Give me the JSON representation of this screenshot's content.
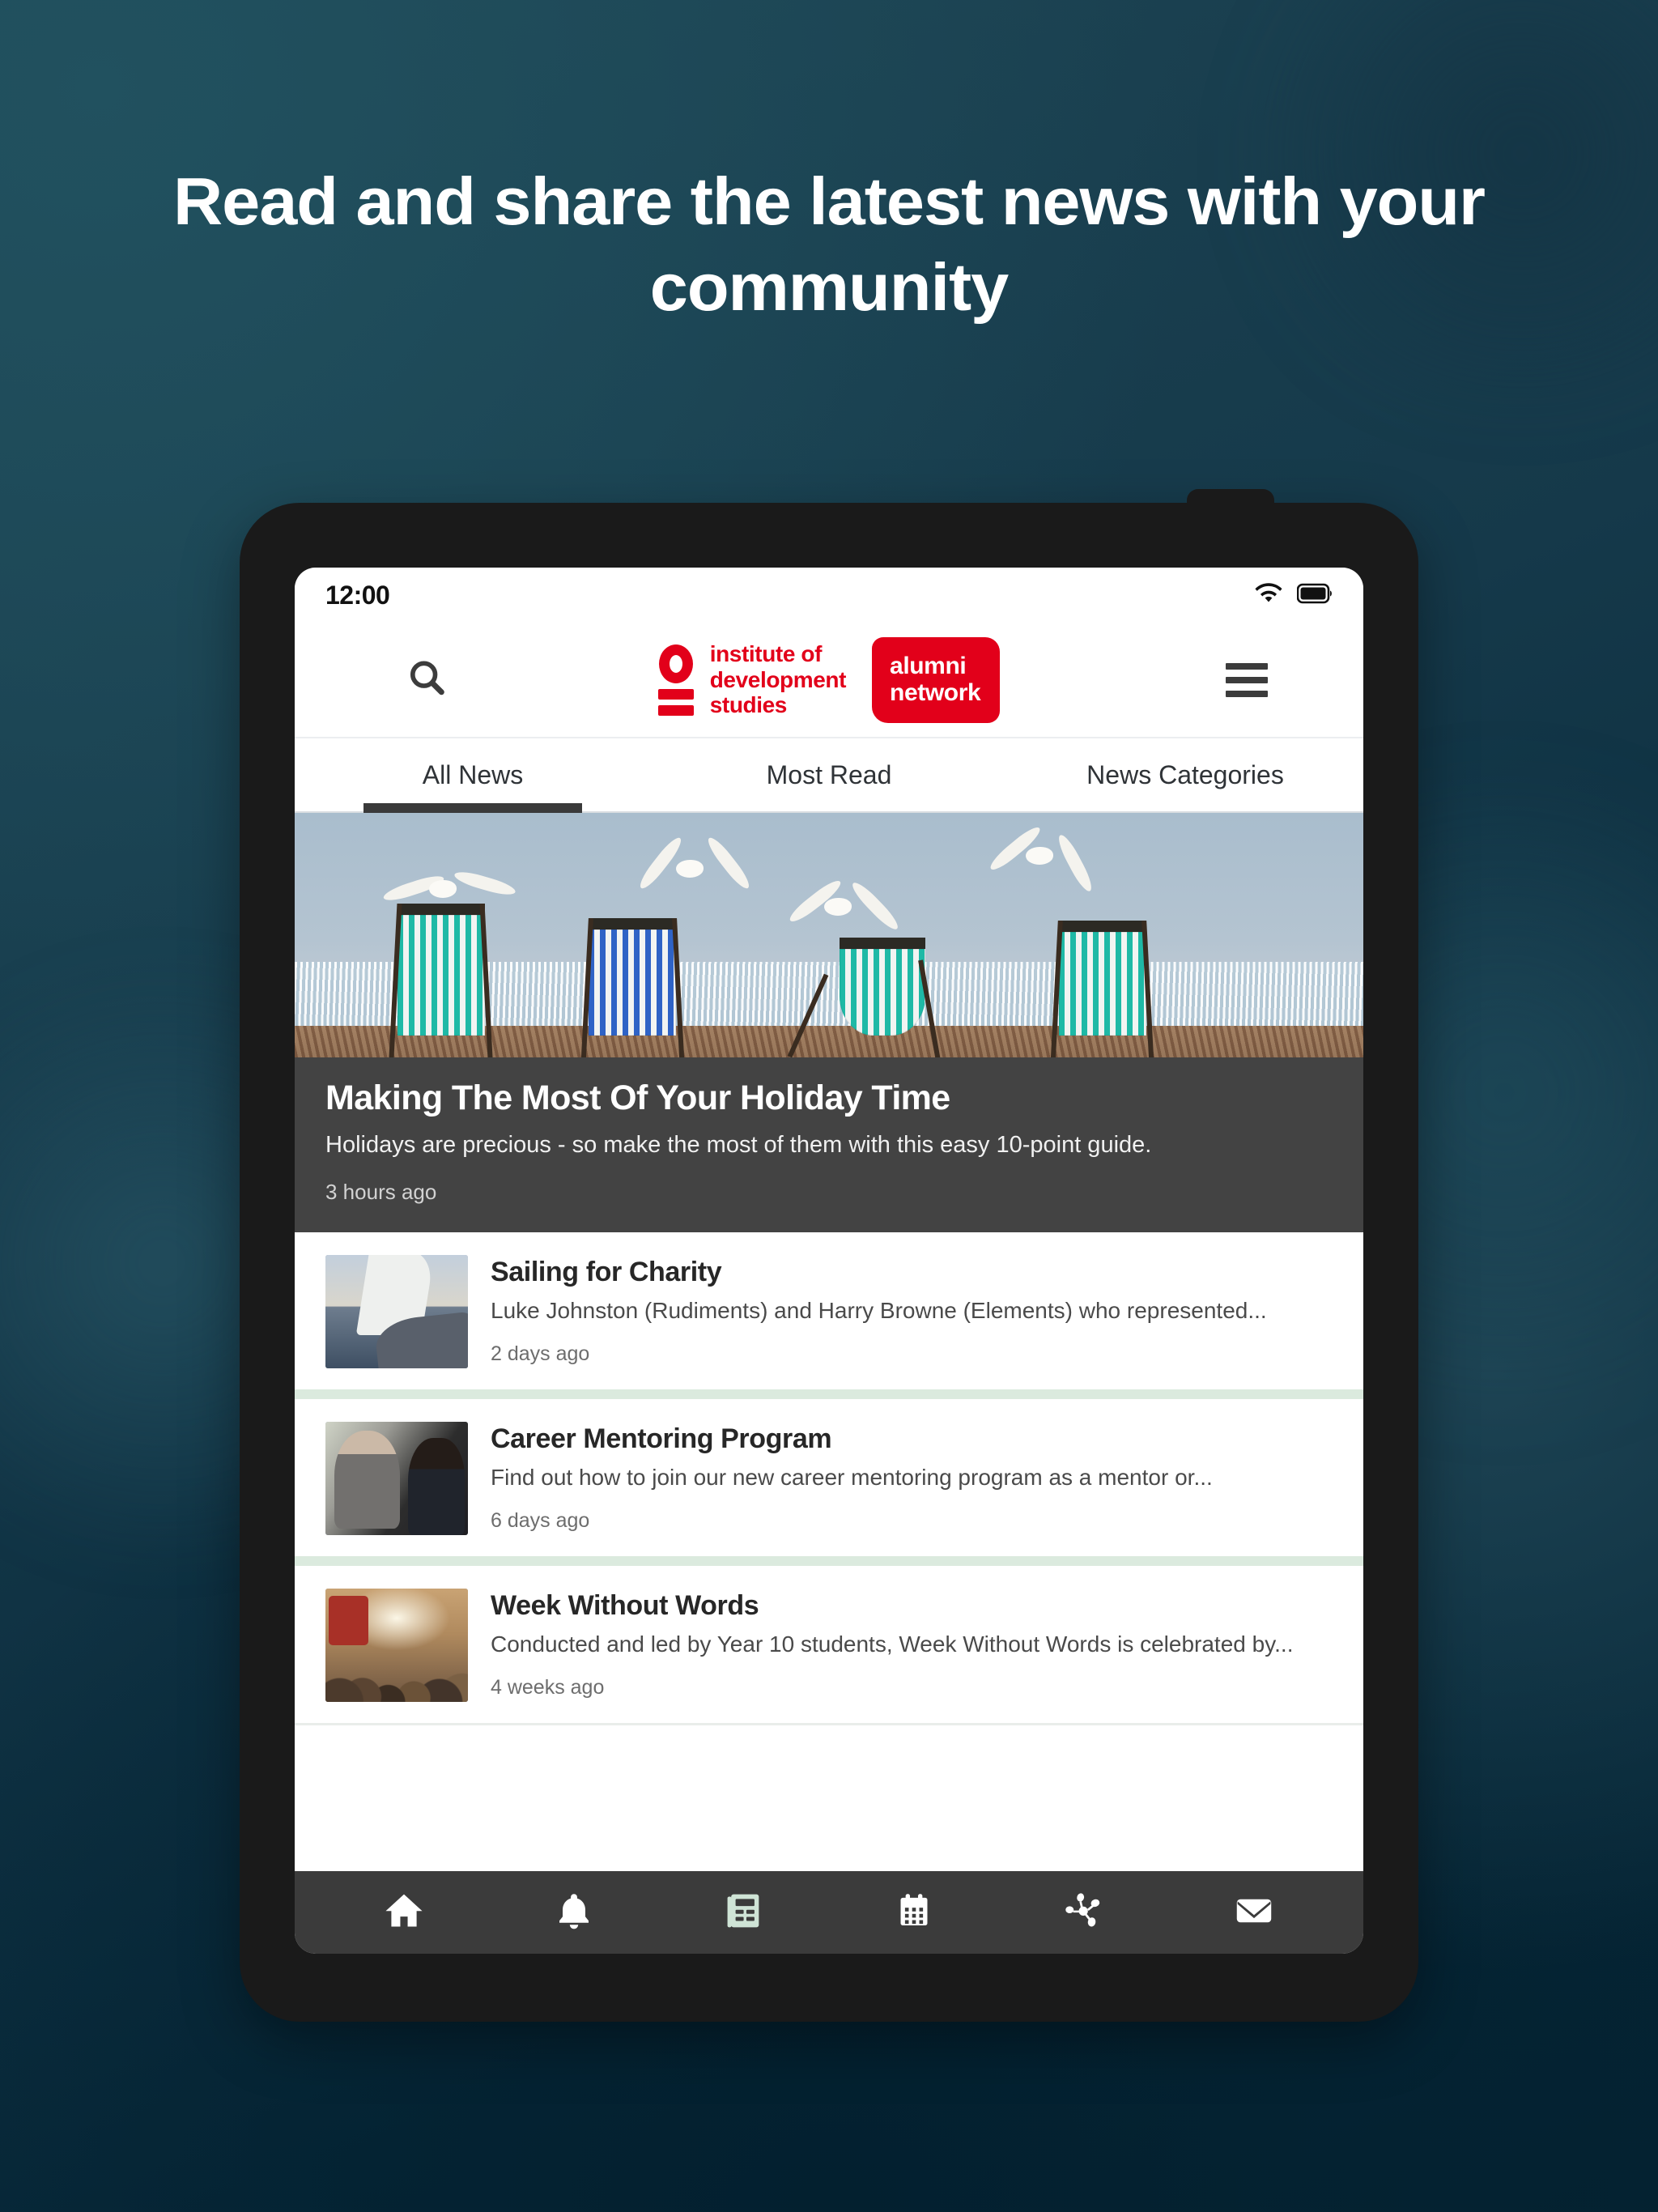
{
  "promo": {
    "headline": "Read and share the latest news with your community",
    "background_color": "#1b3e4b",
    "text_color": "#ffffff"
  },
  "device": {
    "status_bar": {
      "time": "12:00",
      "wifi_icon": "wifi-icon",
      "battery_icon": "battery-full-icon"
    }
  },
  "app_header": {
    "search_icon": "search-icon",
    "menu_icon": "hamburger-menu-icon",
    "logo": {
      "mark": "ids-roundel-icon",
      "line1": "institute of",
      "line2": "development",
      "line3": "studies",
      "badge_line1": "alumni",
      "badge_line2": "network",
      "brand_color": "#e2001a"
    }
  },
  "tabs": {
    "active_index": 0,
    "items": [
      {
        "label": "All News"
      },
      {
        "label": "Most Read"
      },
      {
        "label": "News Categories"
      }
    ]
  },
  "featured": {
    "image_alt": "deckchairs-and-seagulls-on-beach",
    "title": "Making The Most Of Your Holiday Time",
    "summary": "Holidays are precious - so make the most of them with this easy 10-point guide.",
    "time": "3 hours ago"
  },
  "news_list": [
    {
      "thumb": "sailboat-at-sea-thumbnail",
      "title": "Sailing for Charity",
      "summary": "Luke Johnston (Rudiments) and Harry Browne (Elements) who represented...",
      "time": "2 days ago"
    },
    {
      "thumb": "two-people-talking-thumbnail",
      "title": "Career Mentoring Program",
      "summary": "Find out how to join our new career mentoring program as a mentor or...",
      "time": "6 days ago"
    },
    {
      "thumb": "busy-city-street-crowd-thumbnail",
      "title": "Week Without Words",
      "summary": "Conducted and led by Year 10 students, Week Without Words is celebrated by...",
      "time": "4 weeks ago"
    }
  ],
  "bottom_nav": {
    "active_index": 2,
    "active_color": "#cfe4d6",
    "bar_color": "#3b3b3b",
    "items": [
      {
        "icon": "home-icon"
      },
      {
        "icon": "bell-notification-icon"
      },
      {
        "icon": "news-feed-icon"
      },
      {
        "icon": "calendar-icon"
      },
      {
        "icon": "network-share-icon"
      },
      {
        "icon": "envelope-mail-icon"
      }
    ]
  }
}
